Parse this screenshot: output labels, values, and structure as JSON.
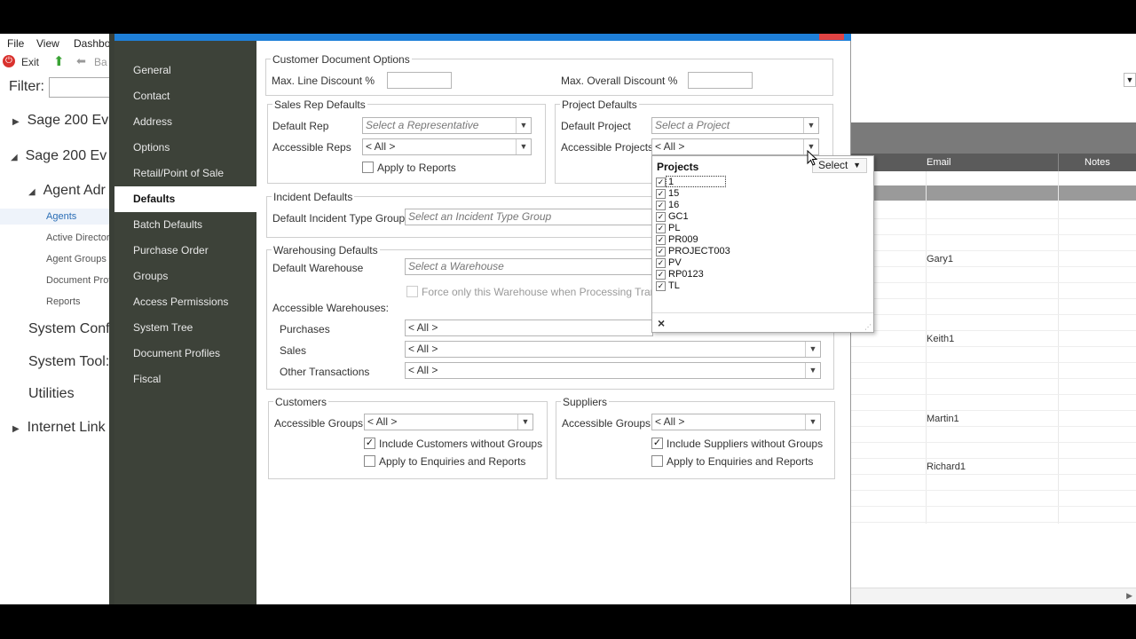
{
  "bg": {
    "menu": [
      "File",
      "View",
      "Dashbo"
    ],
    "toolbar": {
      "exit": "Exit",
      "back": "Ba"
    },
    "filter_label": "Filter:",
    "tree": [
      "Sage 200 Ev",
      "Sage 200 Ev",
      "Agent Adr",
      "System Conf",
      "System Tool:",
      "Utilities",
      "Internet Link"
    ],
    "tree_sub": [
      "Agents",
      "Active Director",
      "Agent Groups",
      "Document Prof",
      "Reports"
    ],
    "grid": {
      "headers": {
        "email": "Email",
        "notes": "Notes"
      },
      "names": [
        "Gary1",
        "Keith1",
        "Martin1",
        "Richard1"
      ]
    }
  },
  "nav": [
    "General",
    "Contact",
    "Address",
    "Options",
    "Retail/Point of Sale",
    "Defaults",
    "Batch Defaults",
    "Purchase Order",
    "Groups",
    "Access Permissions",
    "System Tree",
    "Document Profiles",
    "Fiscal"
  ],
  "cdo": {
    "legend": "Customer Document Options",
    "line_discount": "Max. Line Discount %",
    "overall_discount": "Max. Overall Discount %"
  },
  "srd": {
    "legend": "Sales Rep Defaults",
    "default_rep": "Default Rep",
    "default_rep_ph": "Select a Representative",
    "accessible_reps": "Accessible Reps",
    "accessible_reps_value": "< All >",
    "apply_reports": "Apply to Reports"
  },
  "pd": {
    "legend": "Project Defaults",
    "default_project": "Default Project",
    "default_project_ph": "Select a Project",
    "accessible_projects": "Accessible Projects",
    "accessible_projects_value": "< All >"
  },
  "id": {
    "legend": "Incident Defaults",
    "label": "Default Incident Type Group",
    "ph": "Select an Incident Type Group"
  },
  "wd": {
    "legend": "Warehousing Defaults",
    "default_wh": "Default Warehouse",
    "default_wh_ph": "Select a Warehouse",
    "force": "Force only this Warehouse when Processing Transactio",
    "accessible": "Accessible Warehouses:",
    "purchases": "Purchases",
    "sales": "Sales",
    "other": "Other Transactions",
    "all": "< All >"
  },
  "cust": {
    "legend": "Customers",
    "groups": "Accessible Groups",
    "groups_value": "< All >",
    "include": "Include Customers without Groups",
    "apply": "Apply to Enquiries and Reports"
  },
  "supp": {
    "legend": "Suppliers",
    "groups": "Accessible Groups",
    "groups_value": "< All >",
    "include": "Include Suppliers without Groups",
    "apply": "Apply to Enquiries and Reports"
  },
  "popup": {
    "title": "Projects",
    "items": [
      "1",
      "15",
      "16",
      "GC1",
      "PL",
      "PR009",
      "PROJECT003",
      "PV",
      "RP0123",
      "TL"
    ],
    "close": "×",
    "select_label": "Select"
  },
  "colors": {
    "titlebar": "#1e7fd8",
    "nav_bg": "#3d4239",
    "close": "#e04343"
  }
}
